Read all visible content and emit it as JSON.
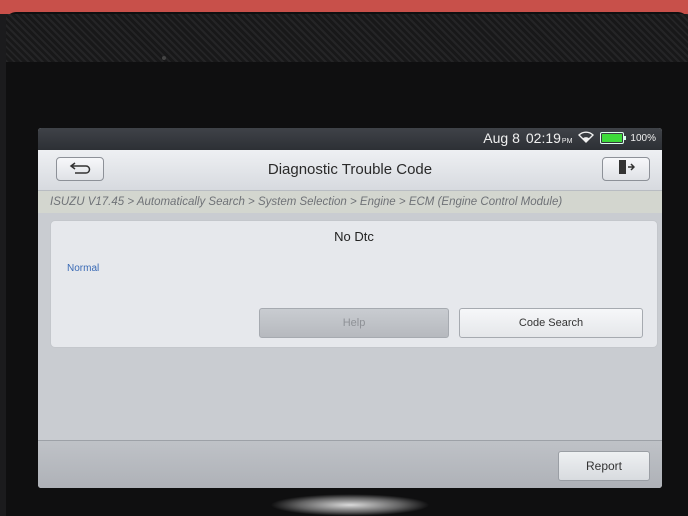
{
  "status_bar": {
    "date": "Aug 8",
    "time": "02:19",
    "ampm": "PM",
    "battery": "100%",
    "battery_level": 1.0
  },
  "title_bar": {
    "title": "Diagnostic Trouble Code",
    "back_icon": "back-arrow-icon",
    "exit_icon": "exit-door-icon"
  },
  "breadcrumb": "ISUZU V17.45 > Automatically Search > System Selection > Engine > ECM (Engine Control Module)",
  "result": {
    "title": "No Dtc",
    "status": "Normal"
  },
  "buttons": {
    "help": "Help",
    "code_search": "Code Search",
    "report": "Report"
  },
  "colors": {
    "status_normal": "#3a6ab5",
    "battery": "#3ddc3a"
  }
}
